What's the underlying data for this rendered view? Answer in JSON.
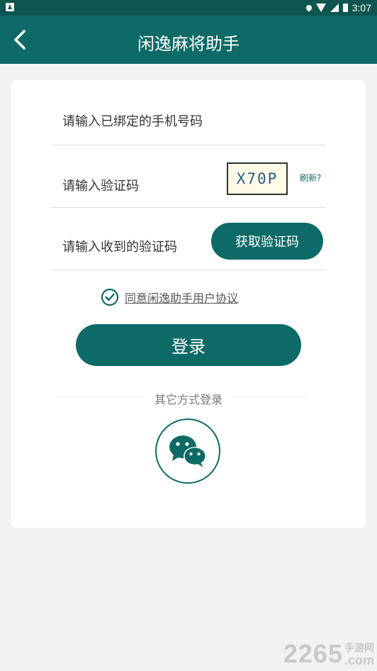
{
  "status_bar": {
    "time": "3:07"
  },
  "header": {
    "title": "闲逸麻将助手"
  },
  "form": {
    "phone_placeholder": "请输入已绑定的手机号码",
    "captcha_placeholder": "请输入验证码",
    "captcha_code": "X70P",
    "refresh_label": "刷新?",
    "sms_code_placeholder": "请输入收到的验证码",
    "get_code_label": "获取验证码",
    "agreement_label": "同意闲逸助手用户协议",
    "agreement_checked": true,
    "login_label": "登录"
  },
  "other_login": {
    "label": "其它方式登录",
    "options": [
      "wechat-icon"
    ]
  },
  "watermark": {
    "number": "2265",
    "cn": "手游网",
    "domain": ".com"
  },
  "colors": {
    "primary": "#0e6a67",
    "status_bar": "#0d5551",
    "background": "#f2f2f2"
  }
}
